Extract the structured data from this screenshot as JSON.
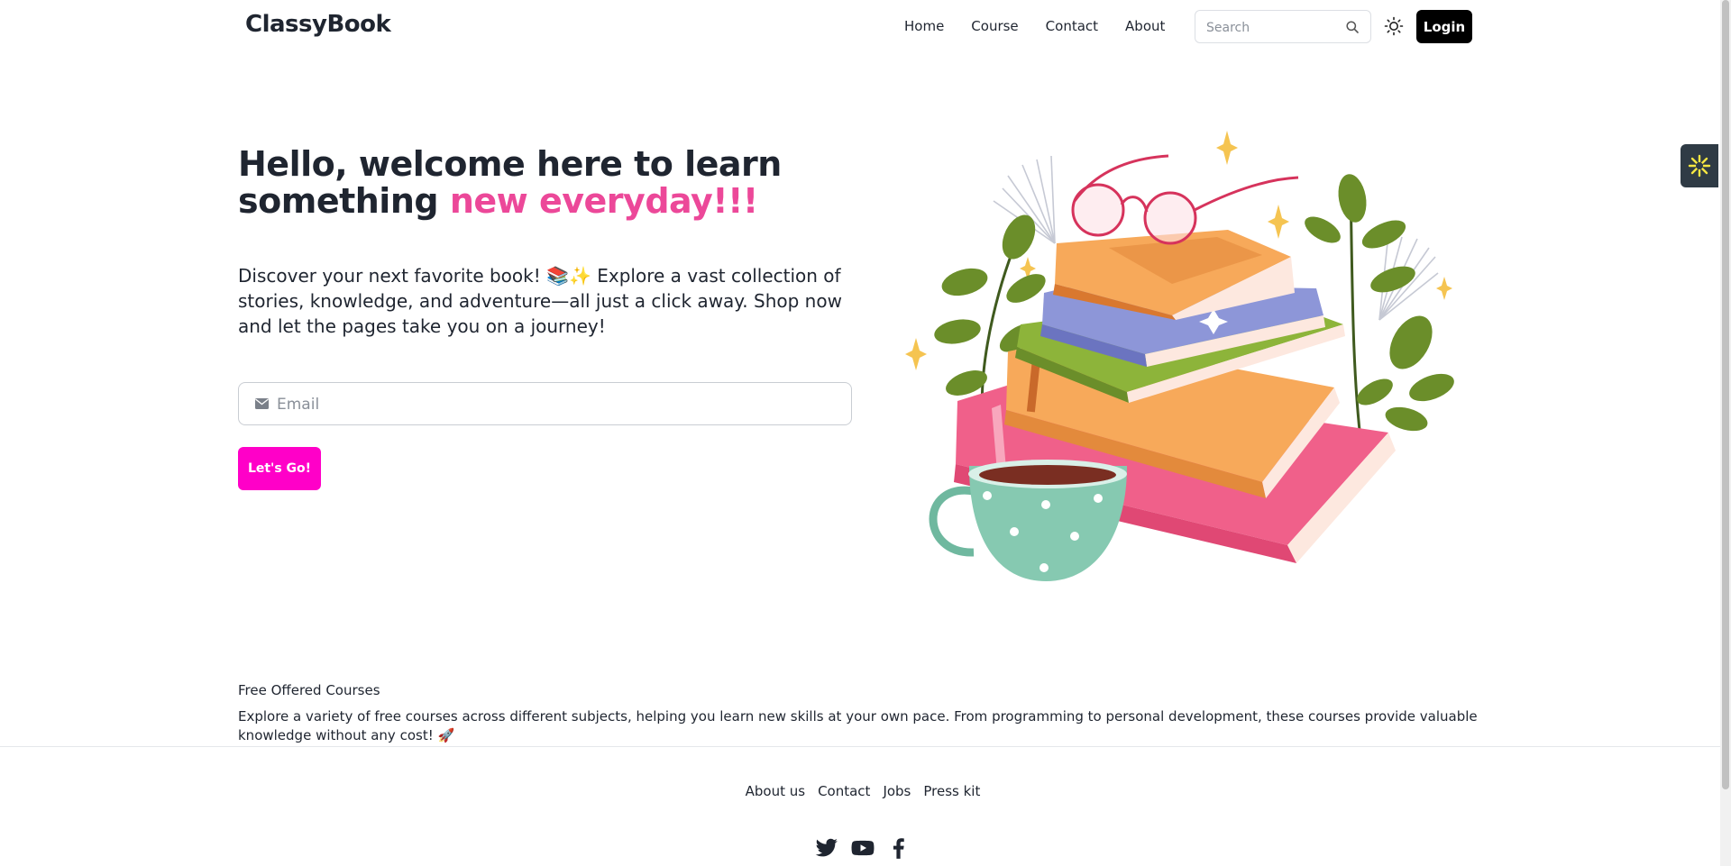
{
  "navbar": {
    "brand": "ClassyBook",
    "links": [
      "Home",
      "Course",
      "Contact",
      "About"
    ],
    "search_placeholder": "Search",
    "login_label": "Login"
  },
  "hero": {
    "title_part1": "Hello, welcome here to learn something ",
    "title_accent": "new everyday!!!",
    "description": "Discover your next favorite book! 📚✨ Explore a vast collection of stories, knowledge, and adventure—all just a click away. Shop now and let the pages take you on a journey!",
    "email_placeholder": "Email",
    "cta_label": "Let's Go!"
  },
  "courses": {
    "title": "Free Offered Courses",
    "description": "Explore a variety of free courses across different subjects, helping you learn new skills at your own pace. From programming to personal development, these courses provide valuable knowledge without any cost! 🚀"
  },
  "footer": {
    "links": [
      "About us",
      "Contact",
      "Jobs",
      "Press kit"
    ],
    "socials": [
      "twitter-icon",
      "youtube-icon",
      "facebook-icon"
    ]
  },
  "colors": {
    "accent_text": "#ec4899",
    "cta_button": "#ff00c8",
    "login_button": "#000000",
    "text": "#1f2530"
  }
}
